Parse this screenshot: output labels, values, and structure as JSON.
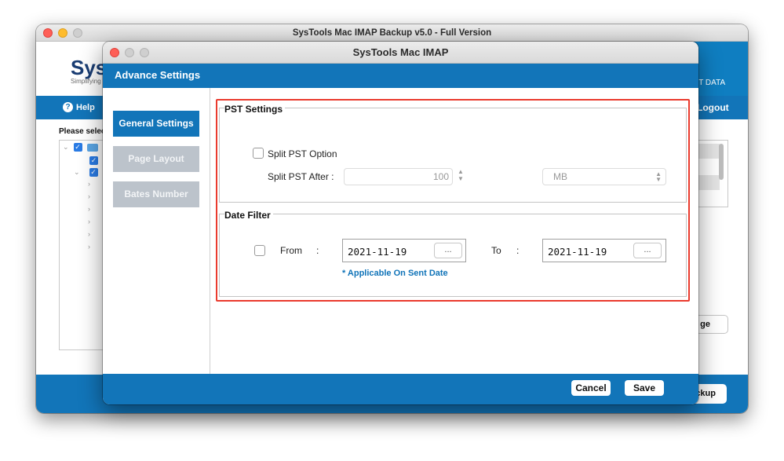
{
  "background_window": {
    "title": "SysTools Mac IMAP Backup v5.0 - Full Version",
    "logo_text": "SysT",
    "logo_subtext": "Simplifying",
    "banner_text": "NT DATA",
    "help_label": "Help",
    "logout_label": "Logout",
    "please_select_label": "Please selec",
    "change_button_label": "ge",
    "backup_button_label": "ckup"
  },
  "dialog": {
    "window_title": "SysTools Mac IMAP",
    "header_title": "Advance Settings",
    "nav": [
      {
        "label": "General Settings",
        "active": true
      },
      {
        "label": "Page Layout",
        "active": false
      },
      {
        "label": "Bates Number",
        "active": false
      }
    ],
    "pst_settings": {
      "title": "PST Settings",
      "split_option_label": "Split PST Option",
      "split_option_checked": false,
      "split_after_label": "Split PST After :",
      "split_after_value": "100",
      "unit_value": "MB"
    },
    "date_filter": {
      "title": "Date Filter",
      "enabled": false,
      "from_label": "From",
      "from_colon": ":",
      "from_value": "2021-11-19",
      "to_label": "To",
      "to_colon": ":",
      "to_value": "2021-11-19",
      "browse_label": "...",
      "note": "* Applicable On Sent Date"
    },
    "buttons": {
      "cancel": "Cancel",
      "save": "Save"
    }
  },
  "colors": {
    "brand_blue": "#1275b9",
    "highlight_red": "#ea3b2e",
    "note_blue": "#0f73b8"
  }
}
